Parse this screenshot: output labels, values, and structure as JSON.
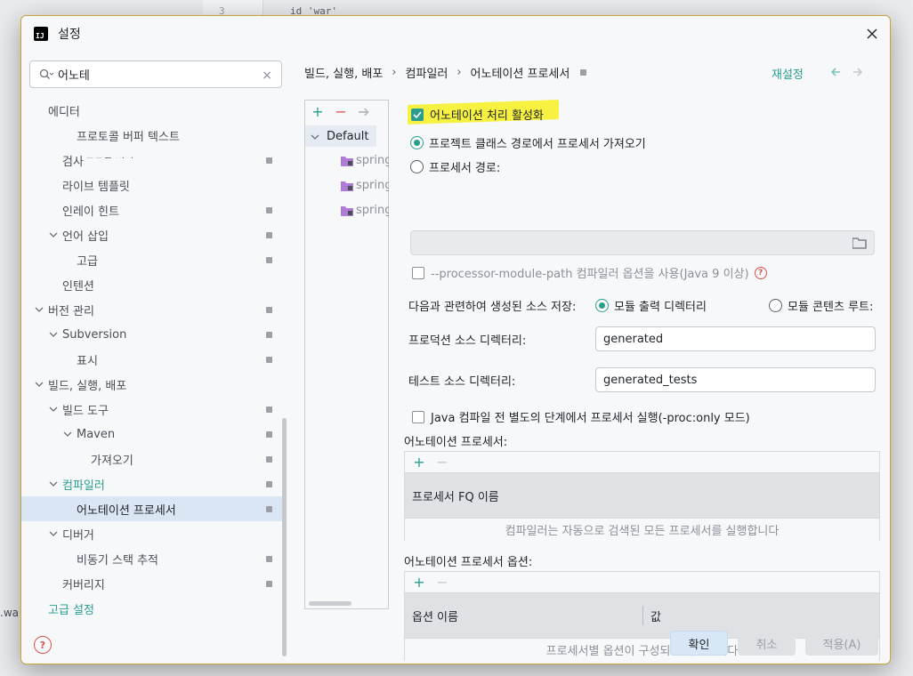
{
  "background": {
    "line_number": "3",
    "code": "id 'war'",
    "left_fragment": ".wa"
  },
  "dialog": {
    "logo_text": "IJ",
    "title": "설정"
  },
  "search": {
    "value": "어노테",
    "placeholder": ""
  },
  "tree": {
    "partial": "프로토콜 버퍼",
    "items": [
      {
        "label": "에디터"
      },
      {
        "label": "프로토콜 버퍼 텍스트"
      },
      {
        "label": "검사"
      },
      {
        "label": "라이브 템플릿"
      },
      {
        "label": "인레이 힌트"
      },
      {
        "label": "언어 삽입"
      },
      {
        "label": "고급"
      },
      {
        "label": "인텐션"
      },
      {
        "label": "버전 관리"
      },
      {
        "label": "Subversion"
      },
      {
        "label": "표시"
      },
      {
        "label": "빌드, 실행, 배포"
      },
      {
        "label": "빌드 도구"
      },
      {
        "label": "Maven"
      },
      {
        "label": "가져오기"
      },
      {
        "label": "컴파일러"
      },
      {
        "label": "어노테이션 프로세서"
      },
      {
        "label": "디버거"
      },
      {
        "label": "비동기 스택 추적"
      },
      {
        "label": "커버리지"
      },
      {
        "label": "고급 설정"
      }
    ]
  },
  "breadcrumb": {
    "items": [
      "빌드, 실행, 배포",
      "컴파일러",
      "어노테이션 프로세서"
    ],
    "reset_label": "재설정"
  },
  "profiles": {
    "default_label": "Default",
    "modules": [
      "spring",
      "spring",
      "spring"
    ]
  },
  "settings": {
    "enable_label": "어노테이션 처리 활성화",
    "enable_checked": true,
    "from_classpath_label": "프로젝트 클래스 경로에서 프로세서 가져오기",
    "processor_path_label": "프로세서 경로:",
    "processor_path_value": "",
    "module_path_label": "--processor-module-path 컴파일러 옵션을 사용(Java 9 이상)",
    "store_generated_label": "다음과 관련하여 생성된 소스 저장:",
    "module_output_label": "모듈 출력 디렉터리",
    "module_content_label": "모듈 콘텐츠 루트:",
    "prod_dir_label": "프로덕션 소스 디렉터리:",
    "prod_dir_value": "generated",
    "test_dir_label": "테스트 소스 디렉터리:",
    "test_dir_value": "generated_tests",
    "proc_only_label": "Java 컴파일 전 별도의 단계에서 프로세서 실행(-proc:only 모드)",
    "processors_section": "어노테이션 프로세서:",
    "processors_header": "프로세서 FQ 이름",
    "processors_empty": "컴파일러는 자동으로 검색된 모든 프로세서를 실행합니다",
    "options_section": "어노테이션 프로세서 옵션:",
    "options_header_name": "옵션 이름",
    "options_header_value": "값",
    "options_empty": "프로세서별 옵션이 구성되지 않았습니다"
  },
  "footer": {
    "ok": "확인",
    "cancel": "취소",
    "apply": "적용(A)"
  },
  "colors": {
    "accent": "#2a9d8f",
    "highlight": "#f6ef2e",
    "selection": "#dbe6f5"
  }
}
